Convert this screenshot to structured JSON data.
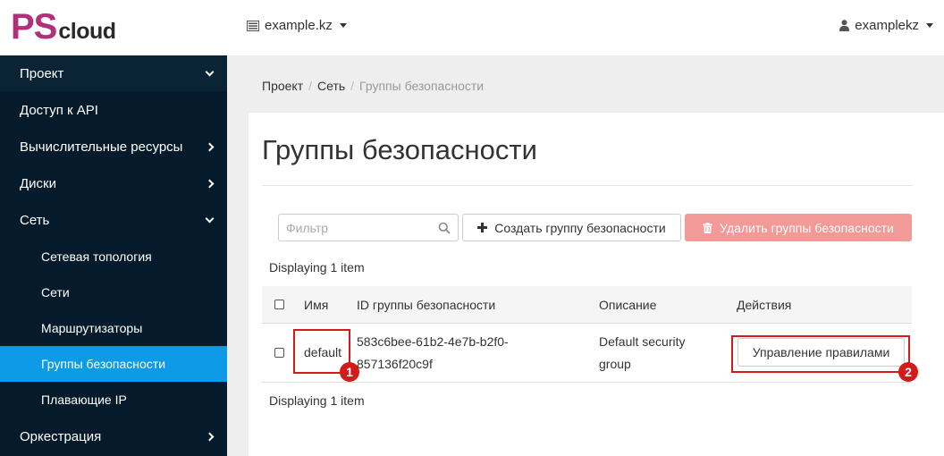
{
  "brand": {
    "ps": "PS",
    "cloud": "cloud"
  },
  "header": {
    "project": "example.kz",
    "user": "examplekz"
  },
  "sidebar": {
    "items": [
      {
        "label": "Проект",
        "chevron": "down"
      },
      {
        "label": "Доступ к API",
        "chevron": ""
      },
      {
        "label": "Вычислительные ресурсы",
        "chevron": "right"
      },
      {
        "label": "Диски",
        "chevron": "right"
      },
      {
        "label": "Сеть",
        "chevron": "down"
      },
      {
        "label": "Сетевая топология",
        "chevron": ""
      },
      {
        "label": "Сети",
        "chevron": ""
      },
      {
        "label": "Маршрутизаторы",
        "chevron": ""
      },
      {
        "label": "Группы безопасности",
        "chevron": ""
      },
      {
        "label": "Плавающие IP",
        "chevron": ""
      },
      {
        "label": "Оркестрация",
        "chevron": "right"
      }
    ]
  },
  "breadcrumb": {
    "item1": "Проект",
    "item2": "Сеть",
    "current": "Группы безопасности",
    "sep": "/"
  },
  "page": {
    "title": "Группы безопасности"
  },
  "toolbar": {
    "filter_placeholder": "Фильтр",
    "create_label": "Создать группу безопасности",
    "delete_label": "Удалить группы безопасности"
  },
  "table": {
    "displaying": "Displaying 1 item",
    "headers": {
      "name": "Имя",
      "id": "ID группы безопасности",
      "description": "Описание",
      "actions": "Действия"
    },
    "rows": [
      {
        "name": "default",
        "id_line1": "583c6bee-61b2-4e7b-b2f0-",
        "id_line2": "857136f20c9f",
        "description_line1": "Default security",
        "description_line2": "group",
        "action": "Управление правилами"
      }
    ]
  },
  "annotations": {
    "badge1": "1",
    "badge2": "2"
  },
  "colors": {
    "brand": "#b0307a",
    "sidebar": "#051b2b",
    "active": "#0d9be8",
    "danger": "#f19a97",
    "highlight": "#d41a1a"
  }
}
